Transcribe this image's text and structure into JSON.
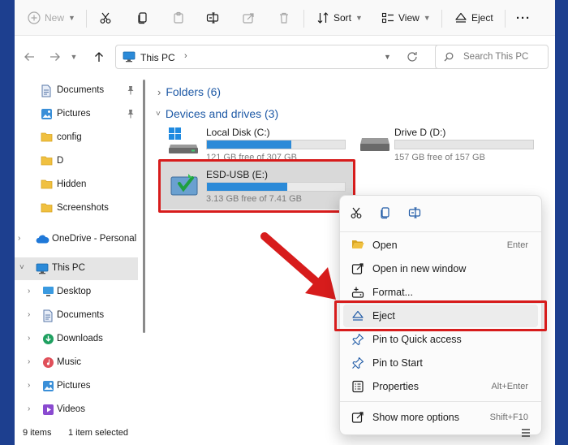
{
  "toolbar": {
    "new_label": "New",
    "sort_label": "Sort",
    "view_label": "View",
    "eject_label": "Eject",
    "more_label": "···"
  },
  "address": {
    "path": "This PC",
    "search_placeholder": "Search This PC"
  },
  "sidebar": {
    "quick": [
      {
        "label": "Documents",
        "pinned": true
      },
      {
        "label": "Pictures",
        "pinned": true
      },
      {
        "label": "config"
      },
      {
        "label": "D"
      },
      {
        "label": "Hidden"
      },
      {
        "label": "Screenshots"
      }
    ],
    "onedrive": "OneDrive - Personal",
    "thispc": "This PC",
    "pc_items": [
      "Desktop",
      "Documents",
      "Downloads",
      "Music",
      "Pictures",
      "Videos"
    ]
  },
  "content": {
    "folders_header": "Folders (6)",
    "devices_header": "Devices and drives (3)",
    "drives": [
      {
        "name": "Local Disk (C:)",
        "free": "121 GB free of 307 GB",
        "used_fraction": 0.61
      },
      {
        "name": "Drive D (D:)",
        "free": "157 GB free of 157 GB",
        "used_fraction": 0.0
      },
      {
        "name": "ESD-USB (E:)",
        "free": "3.13 GB free of 7.41 GB",
        "used_fraction": 0.58
      }
    ]
  },
  "context_menu": {
    "items": [
      {
        "label": "Open",
        "shortcut": "Enter"
      },
      {
        "label": "Open in new window",
        "shortcut": ""
      },
      {
        "label": "Format...",
        "shortcut": ""
      },
      {
        "label": "Eject",
        "shortcut": ""
      },
      {
        "label": "Pin to Quick access",
        "shortcut": ""
      },
      {
        "label": "Pin to Start",
        "shortcut": ""
      },
      {
        "label": "Properties",
        "shortcut": "Alt+Enter"
      },
      {
        "label": "Show more options",
        "shortcut": "Shift+F10"
      }
    ]
  },
  "status": {
    "items": "9 items",
    "selected": "1 item selected"
  },
  "colors": {
    "accent": "#2b8ad8",
    "highlight_box": "#d71c1c",
    "section_header": "#1f5aa6",
    "desktop": "#1d3f8f"
  }
}
